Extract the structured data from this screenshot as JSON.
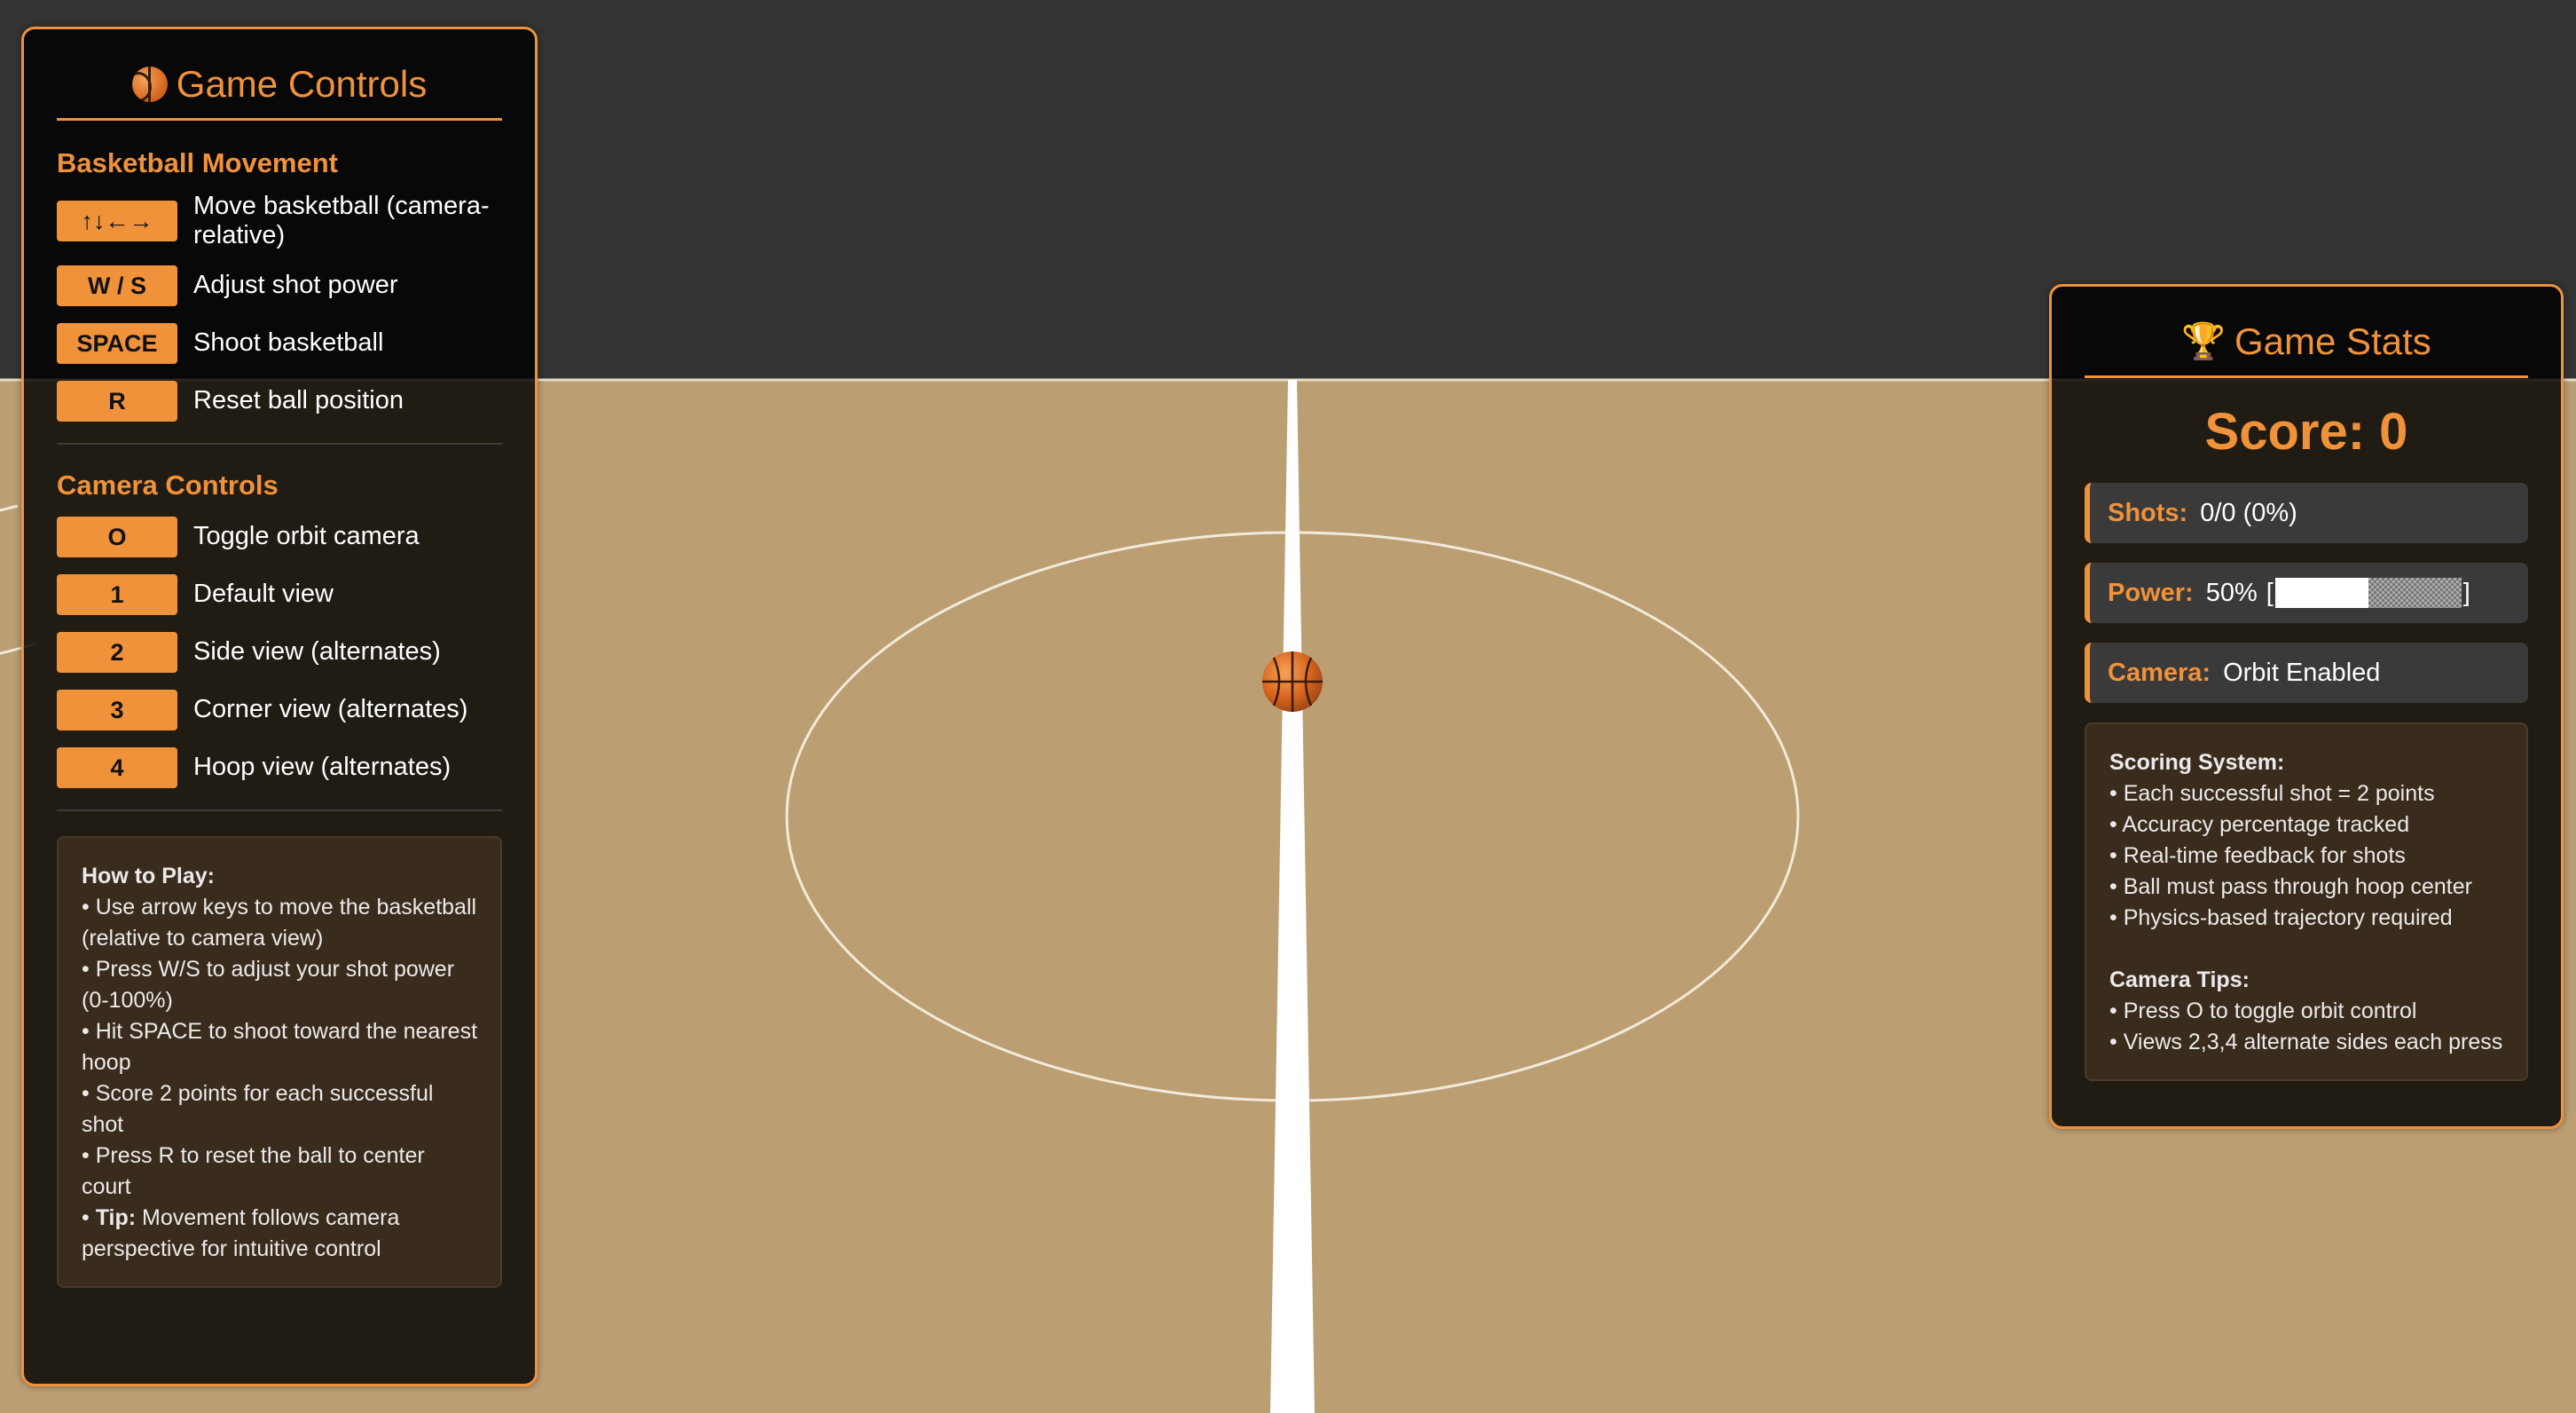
{
  "controls": {
    "title": "Game Controls",
    "icon": "basketball-icon",
    "movement_heading": "Basketball Movement",
    "movement": [
      {
        "key": "↑↓←→",
        "desc": "Move basketball (camera-relative)"
      },
      {
        "key": "W / S",
        "desc": "Adjust shot power"
      },
      {
        "key": "SPACE",
        "desc": "Shoot basketball"
      },
      {
        "key": "R",
        "desc": "Reset ball position"
      }
    ],
    "camera_heading": "Camera Controls",
    "camera": [
      {
        "key": "O",
        "desc": "Toggle orbit camera"
      },
      {
        "key": "1",
        "desc": "Default view"
      },
      {
        "key": "2",
        "desc": "Side view (alternates)"
      },
      {
        "key": "3",
        "desc": "Corner view (alternates)"
      },
      {
        "key": "4",
        "desc": "Hoop view (alternates)"
      }
    ],
    "how_to_play": {
      "title": "How to Play:",
      "items": [
        "• Use arrow keys to move the basketball (relative to camera view)",
        "• Press W/S to adjust your shot power (0-100%)",
        "• Hit SPACE to shoot toward the nearest hoop",
        "• Score 2 points for each successful shot",
        "• Press R to reset the ball to center court"
      ],
      "tip_prefix": "• ",
      "tip_label": "Tip:",
      "tip_text": " Movement follows camera perspective for intuitive control"
    }
  },
  "stats": {
    "title": "Game Stats",
    "icon": "trophy-icon",
    "score_text": "Score: 0",
    "shots_label": "Shots:",
    "shots_value": "0/0 (0%)",
    "power_label": "Power:",
    "power_value": "50%",
    "power_fraction": 0.5,
    "power_open": "[",
    "power_close": "]",
    "camera_label": "Camera:",
    "camera_value": "Orbit Enabled",
    "scoring_title": "Scoring System:",
    "scoring_items": [
      "• Each successful shot = 2 points",
      "• Accuracy percentage tracked",
      "• Real-time feedback for shots",
      "• Ball must pass through hoop center",
      "• Physics-based trajectory required"
    ],
    "camera_tips_title": "Camera Tips:",
    "camera_tips_items": [
      "• Press O to toggle orbit control",
      "• Views 2,3,4 alternate sides each press"
    ]
  },
  "colors": {
    "accent": "#f0923a",
    "court": "#bc9e73",
    "background": "#333333",
    "lines": "#ffffff"
  }
}
